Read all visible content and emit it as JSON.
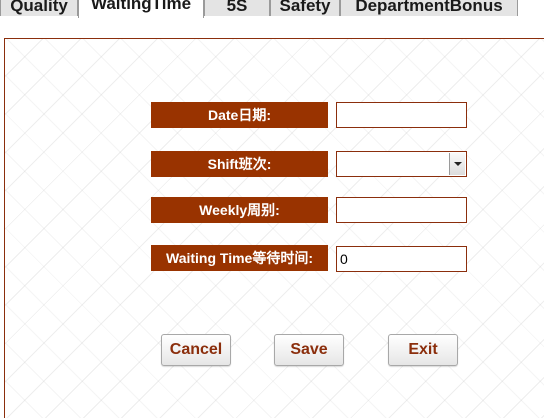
{
  "tabs": [
    {
      "label": "Quality"
    },
    {
      "label": "WaitingTime",
      "active": true
    },
    {
      "label": "5S"
    },
    {
      "label": "Safety"
    },
    {
      "label": "DepartmentBonus"
    }
  ],
  "form": {
    "date_label": "Date日期:",
    "date_value": "",
    "shift_label": "Shift班次:",
    "shift_value": "",
    "weekly_label": "Weekly周别:",
    "weekly_value": "",
    "waiting_label": "Waiting Time等待时间:",
    "waiting_value": "0"
  },
  "buttons": {
    "cancel": "Cancel",
    "save": "Save",
    "exit": "Exit"
  },
  "colors": {
    "label_bg": "#993300",
    "border": "#8b2e0c",
    "button_text": "#8b2e0c"
  }
}
